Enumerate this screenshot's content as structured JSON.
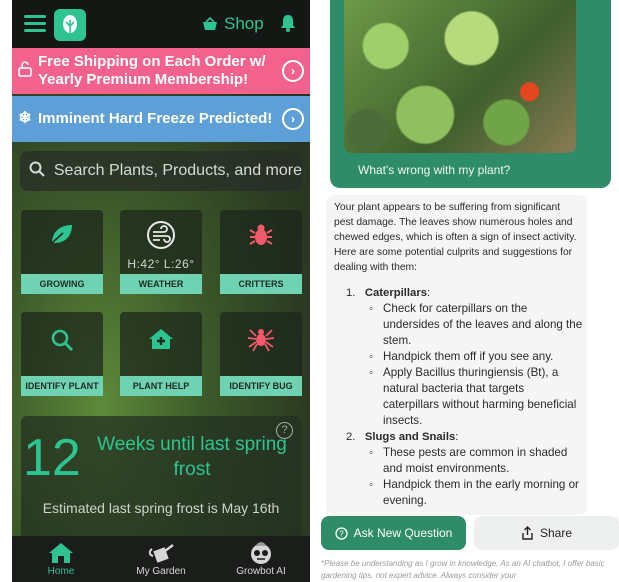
{
  "left": {
    "topbar": {
      "shop_label": "Shop"
    },
    "banners": [
      {
        "text": "Free Shipping on Each Order w/ Yearly Premium Membership!",
        "color": "#f2628c",
        "icon": "lock-icon"
      },
      {
        "text": "Imminent Hard Freeze Predicted!",
        "color": "#5e9fd8",
        "icon": "snowflake-icon"
      }
    ],
    "search": {
      "placeholder": "Search Plants, Products, and more"
    },
    "tiles": [
      {
        "label": "GROWING",
        "icon": "leaf-icon"
      },
      {
        "label": "WEATHER",
        "icon": "wind-icon",
        "reading": "H:42° L:26°"
      },
      {
        "label": "CRITTERS",
        "icon": "bug-icon"
      },
      {
        "label": "IDENTIFY PLANT",
        "icon": "search-icon"
      },
      {
        "label": "PLANT HELP",
        "icon": "house-plus-icon"
      },
      {
        "label": "IDENTIFY BUG",
        "icon": "spider-icon"
      }
    ],
    "frost": {
      "weeks": "12",
      "title": "Weeks until last spring frost",
      "estimate": "Estimated last spring frost is May 16th"
    },
    "nav": [
      {
        "label": "Home",
        "icon": "home-icon",
        "active": true
      },
      {
        "label": "My Garden",
        "icon": "watering-can-icon",
        "active": false
      },
      {
        "label": "Growbot AI",
        "icon": "robot-icon",
        "active": false
      }
    ],
    "accent": "#2ec492"
  },
  "right": {
    "question": "What's wrong with my plant?",
    "answer_intro": "Your plant appears to be suffering from significant pest damage. The leaves show numerous holes and chewed edges, which is often a sign of insect activity. Here are some potential culprits and suggestions for dealing with them:",
    "sections": [
      {
        "title": "Caterpillars",
        "number": "1.",
        "bullets": [
          "Check for caterpillars on the undersides of the leaves and along the stem.",
          "Handpick them off if you see any.",
          "Apply Bacillus thuringiensis (Bt), a natural bacteria that targets caterpillars without harming beneficial insects."
        ]
      },
      {
        "title": "Slugs and Snails",
        "number": "2.",
        "bullets": [
          "These pests are common in shaded and moist environments.",
          "Handpick them in the early morning or evening."
        ]
      }
    ],
    "ask_button": "Ask New Question",
    "share_button": "Share",
    "disclaimer": "*Please be understanding as I grow in knowledge. As an AI chatbot, I offer basic gardening tips, not expert advice. Always consider your"
  }
}
